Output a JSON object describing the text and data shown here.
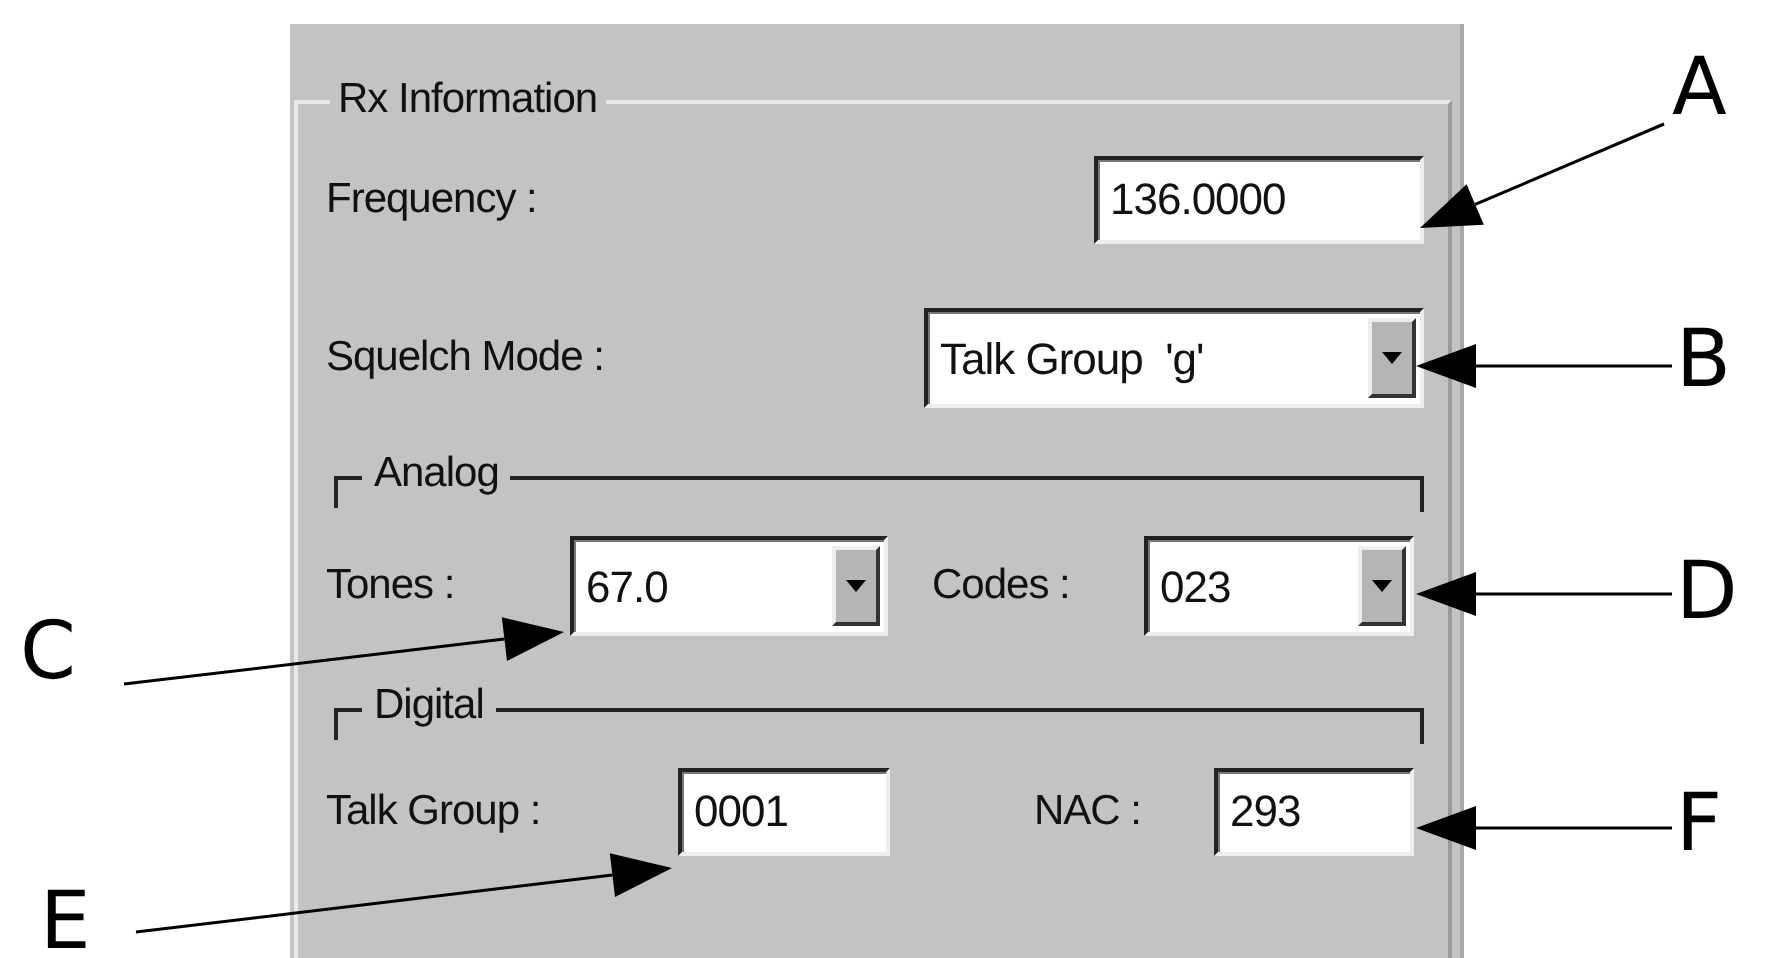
{
  "group": {
    "title": "Rx Information"
  },
  "frequency": {
    "label": "Frequency :",
    "value": "136.0000"
  },
  "squelch_mode": {
    "label": "Squelch Mode :",
    "value": "Talk Group  'g'"
  },
  "analog": {
    "title": "Analog",
    "tones": {
      "label": "Tones :",
      "value": "67.0"
    },
    "codes": {
      "label": "Codes :",
      "value": "023"
    }
  },
  "digital": {
    "title": "Digital",
    "talk_group": {
      "label": "Talk Group :",
      "value": "0001"
    },
    "nac": {
      "label": "NAC :",
      "value": "293"
    }
  },
  "callouts": [
    {
      "letter": "A"
    },
    {
      "letter": "B"
    },
    {
      "letter": "C"
    },
    {
      "letter": "D"
    },
    {
      "letter": "E"
    },
    {
      "letter": "F"
    }
  ]
}
